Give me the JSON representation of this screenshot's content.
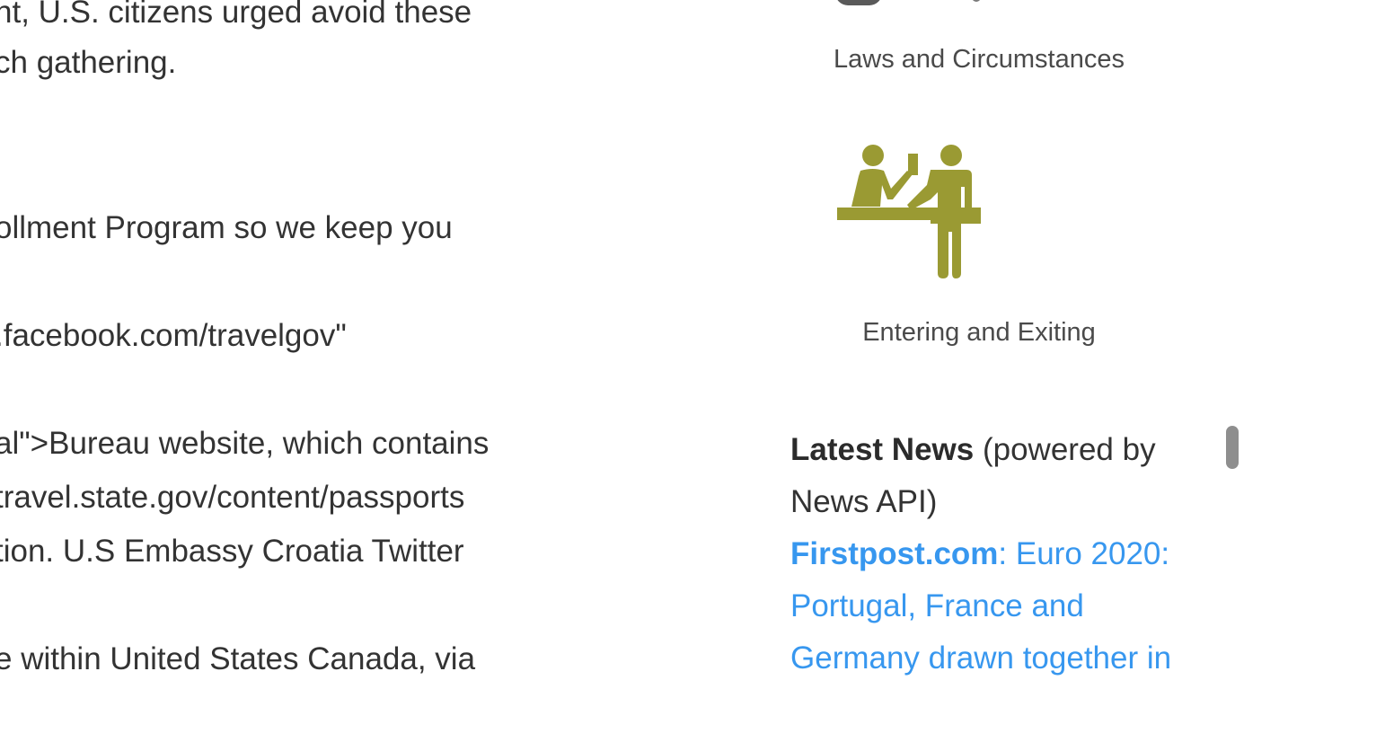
{
  "article": {
    "lines": [
      "nt, U.S. citizens urged avoid these",
      "ch gathering.",
      "ollment Program so we keep you",
      ".facebook.com/travelgov\"",
      "al\">Bureau website, which contains",
      "travel.state.gov/content/passports",
      "tion. U.S Embassy Croatia Twitter",
      "e within United States Canada, via"
    ]
  },
  "sidebar": {
    "tiles": [
      {
        "label": "Laws and Circumstances",
        "icon": "laws-icon"
      },
      {
        "label": "Entering and Exiting",
        "icon": "immigration-desk-icon",
        "color": "#9a9a33"
      }
    ],
    "news": {
      "heading_bold": "Latest News",
      "heading_rest": " (powered by News API)",
      "item_source": "Firstpost.com",
      "item_title": ": Euro 2020: Portugal, France and Germany drawn together in"
    }
  },
  "colors": {
    "text": "#333333",
    "link": "#3797ef",
    "icon_olive": "#9a9a33",
    "scrollbar": "#8e8e8e"
  }
}
